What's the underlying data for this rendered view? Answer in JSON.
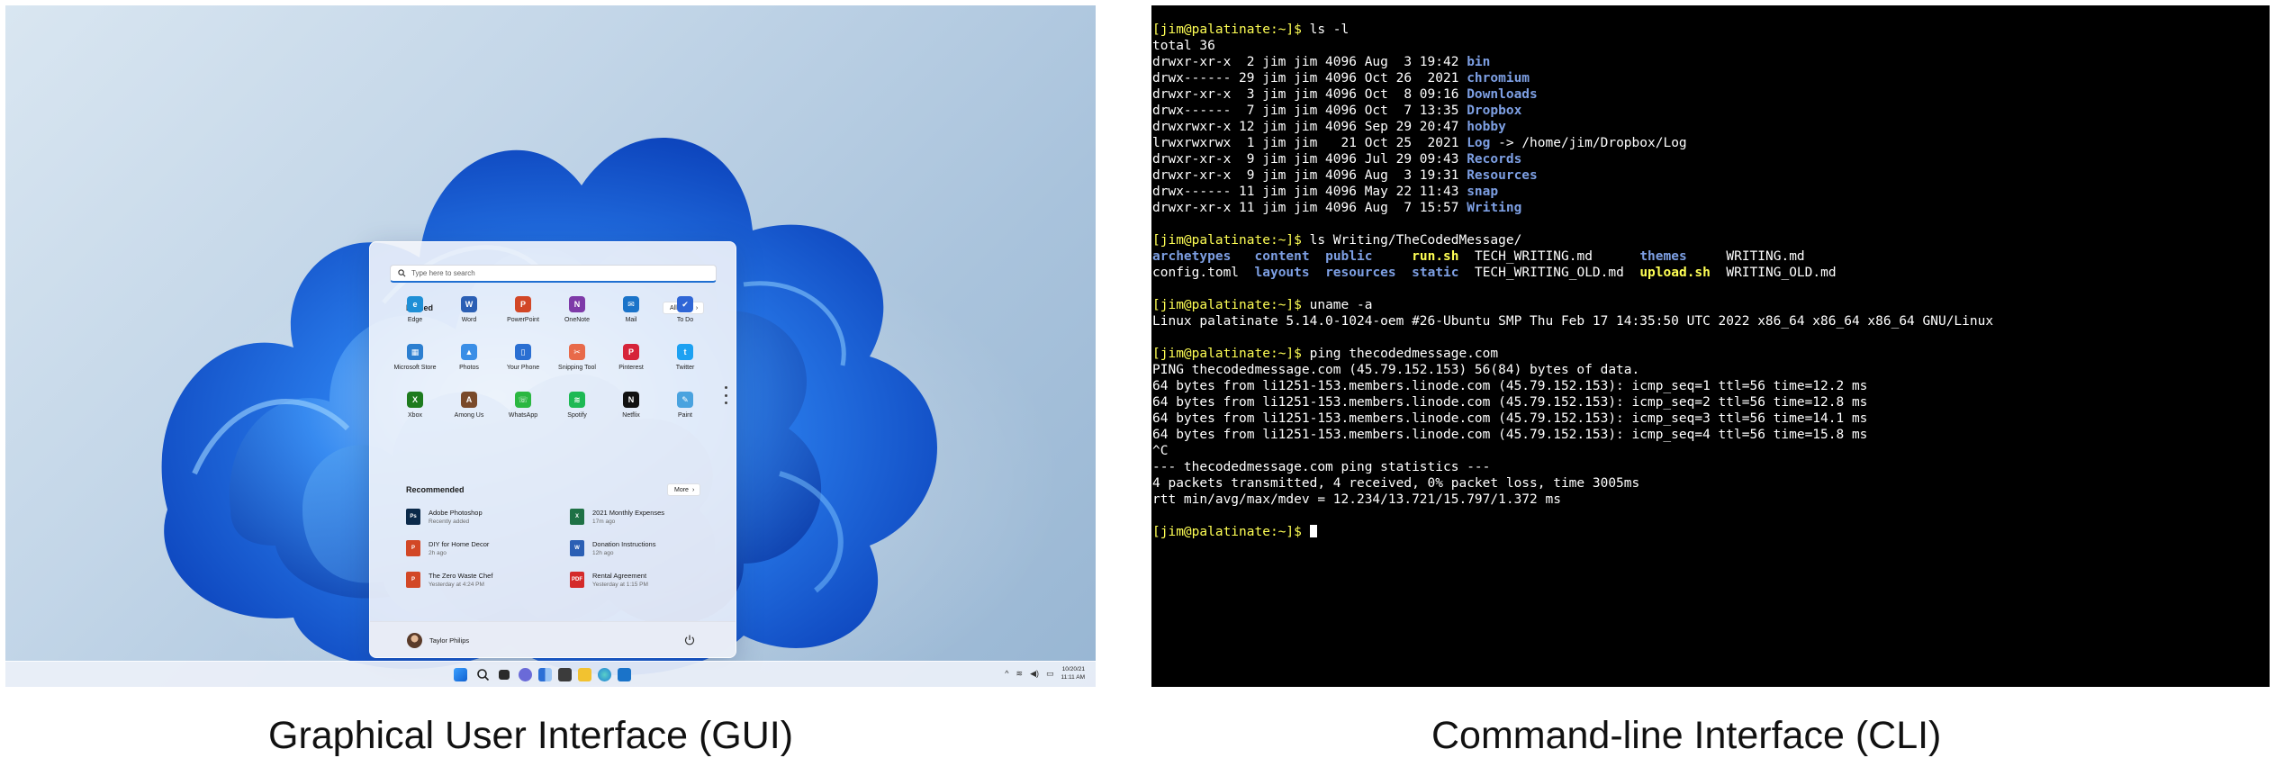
{
  "gui": {
    "search_placeholder": "Type here to search",
    "pinned_title": "Pinned",
    "all_apps_label": "All apps",
    "pinned_apps": [
      {
        "label": "Edge",
        "icon": "edge-icon",
        "color": "#1f8fd6",
        "glyph": "e"
      },
      {
        "label": "Word",
        "icon": "word-icon",
        "color": "#2b5fb4",
        "glyph": "W"
      },
      {
        "label": "PowerPoint",
        "icon": "powerpoint-icon",
        "color": "#d24726",
        "glyph": "P"
      },
      {
        "label": "OneNote",
        "icon": "onenote-icon",
        "color": "#7e3aa8",
        "glyph": "N"
      },
      {
        "label": "Mail",
        "icon": "mail-icon",
        "color": "#1a73c9",
        "glyph": "✉"
      },
      {
        "label": "To Do",
        "icon": "todo-icon",
        "color": "#2f66d6",
        "glyph": "✔"
      },
      {
        "label": "Microsoft Store",
        "icon": "store-icon",
        "color": "#2c7fd0",
        "glyph": "▦"
      },
      {
        "label": "Photos",
        "icon": "photos-icon",
        "color": "#3a8ee6",
        "glyph": "▲"
      },
      {
        "label": "Your Phone",
        "icon": "phone-icon",
        "color": "#2a6fd2",
        "glyph": "▯"
      },
      {
        "label": "Snipping Tool",
        "icon": "snipping-tool-icon",
        "color": "#e86a4a",
        "glyph": "✂"
      },
      {
        "label": "Pinterest",
        "icon": "pinterest-icon",
        "color": "#d6243a",
        "glyph": "P"
      },
      {
        "label": "Twitter",
        "icon": "twitter-icon",
        "color": "#1da1f2",
        "glyph": "t"
      },
      {
        "label": "Xbox",
        "icon": "xbox-icon",
        "color": "#1e7b1e",
        "glyph": "X"
      },
      {
        "label": "Among Us",
        "icon": "among-us-icon",
        "color": "#7a4a2a",
        "glyph": "A"
      },
      {
        "label": "WhatsApp",
        "icon": "whatsapp-icon",
        "color": "#2bb741",
        "glyph": "☏"
      },
      {
        "label": "Spotify",
        "icon": "spotify-icon",
        "color": "#1db954",
        "glyph": "≋"
      },
      {
        "label": "Netflix",
        "icon": "netflix-icon",
        "color": "#111111",
        "glyph": "N"
      },
      {
        "label": "Paint",
        "icon": "paint-icon",
        "color": "#4aa3df",
        "glyph": "✎"
      }
    ],
    "recommended_title": "Recommended",
    "more_label": "More",
    "recommended": [
      {
        "name": "Adobe Photoshop",
        "time": "Recently added",
        "icon": "photoshop-icon",
        "color": "#0b2a4a",
        "glyph": "Ps"
      },
      {
        "name": "2021 Monthly Expenses",
        "time": "17m ago",
        "icon": "excel-icon",
        "color": "#1e7145",
        "glyph": "X"
      },
      {
        "name": "DIY for Home Decor",
        "time": "2h ago",
        "icon": "powerpoint-file-icon",
        "color": "#d24726",
        "glyph": "P"
      },
      {
        "name": "Donation Instructions",
        "time": "12h ago",
        "icon": "word-file-icon",
        "color": "#2b5fb4",
        "glyph": "W"
      },
      {
        "name": "The Zero Waste Chef",
        "time": "Yesterday at 4:24 PM",
        "icon": "powerpoint-file-icon",
        "color": "#d24726",
        "glyph": "P"
      },
      {
        "name": "Rental Agreement",
        "time": "Yesterday at 1:15 PM",
        "icon": "pdf-file-icon",
        "color": "#d42a2a",
        "glyph": "PDF"
      }
    ],
    "user_name": "Taylor Philips",
    "clock_date": "10/20/21",
    "clock_time": "11:11 AM"
  },
  "cli": {
    "lines": [
      [
        {
          "t": "[jim@palatinate:~]$",
          "c": "prompt"
        },
        {
          "t": " ls -l"
        }
      ],
      [
        {
          "t": "total 36"
        }
      ],
      [
        {
          "t": "drwxr-xr-x  2 jim jim 4096 Aug  3 19:42 "
        },
        {
          "t": "bin",
          "c": "dir"
        }
      ],
      [
        {
          "t": "drwx------ 29 jim jim 4096 Oct 26  2021 "
        },
        {
          "t": "chromium",
          "c": "dir"
        }
      ],
      [
        {
          "t": "drwxr-xr-x  3 jim jim 4096 Oct  8 09:16 "
        },
        {
          "t": "Downloads",
          "c": "dir"
        }
      ],
      [
        {
          "t": "drwx------  7 jim jim 4096 Oct  7 13:35 "
        },
        {
          "t": "Dropbox",
          "c": "dir"
        }
      ],
      [
        {
          "t": "drwxrwxr-x 12 jim jim 4096 Sep 29 20:47 "
        },
        {
          "t": "hobby",
          "c": "dir"
        }
      ],
      [
        {
          "t": "lrwxrwxrwx  1 jim jim   21 Oct 25  2021 "
        },
        {
          "t": "Log",
          "c": "dir"
        },
        {
          "t": " -> /home/jim/Dropbox/Log"
        }
      ],
      [
        {
          "t": "drwxr-xr-x  9 jim jim 4096 Jul 29 09:43 "
        },
        {
          "t": "Records",
          "c": "dir"
        }
      ],
      [
        {
          "t": "drwxr-xr-x  9 jim jim 4096 Aug  3 19:31 "
        },
        {
          "t": "Resources",
          "c": "dir"
        }
      ],
      [
        {
          "t": "drwx------ 11 jim jim 4096 May 22 11:43 "
        },
        {
          "t": "snap",
          "c": "dir"
        }
      ],
      [
        {
          "t": "drwxr-xr-x 11 jim jim 4096 Aug  7 15:57 "
        },
        {
          "t": "Writing",
          "c": "dir"
        }
      ],
      [],
      [
        {
          "t": "[jim@palatinate:~]$",
          "c": "prompt"
        },
        {
          "t": " ls Writing/TheCodedMessage/"
        }
      ],
      [
        {
          "t": "archetypes",
          "c": "dir"
        },
        {
          "t": "   "
        },
        {
          "t": "content",
          "c": "dir"
        },
        {
          "t": "  "
        },
        {
          "t": "public",
          "c": "dir"
        },
        {
          "t": "     "
        },
        {
          "t": "run.sh",
          "c": "exe"
        },
        {
          "t": "  TECH_WRITING.md      "
        },
        {
          "t": "themes",
          "c": "dir"
        },
        {
          "t": "     WRITING.md"
        }
      ],
      [
        {
          "t": "config.toml  "
        },
        {
          "t": "layouts",
          "c": "dir"
        },
        {
          "t": "  "
        },
        {
          "t": "resources",
          "c": "dir"
        },
        {
          "t": "  "
        },
        {
          "t": "static",
          "c": "dir"
        },
        {
          "t": "  TECH_WRITING_OLD.md  "
        },
        {
          "t": "upload.sh",
          "c": "exe"
        },
        {
          "t": "  WRITING_OLD.md"
        }
      ],
      [],
      [
        {
          "t": "[jim@palatinate:~]$",
          "c": "prompt"
        },
        {
          "t": " uname -a"
        }
      ],
      [
        {
          "t": "Linux palatinate 5.14.0-1024-oem #26-Ubuntu SMP Thu Feb 17 14:35:50 UTC 2022 x86_64 x86_64 x86_64 GNU/Linux"
        }
      ],
      [],
      [
        {
          "t": "[jim@palatinate:~]$",
          "c": "prompt"
        },
        {
          "t": " ping thecodedmessage.com"
        }
      ],
      [
        {
          "t": "PING thecodedmessage.com (45.79.152.153) 56(84) bytes of data."
        }
      ],
      [
        {
          "t": "64 bytes from li1251-153.members.linode.com (45.79.152.153): icmp_seq=1 ttl=56 time=12.2 ms"
        }
      ],
      [
        {
          "t": "64 bytes from li1251-153.members.linode.com (45.79.152.153): icmp_seq=2 ttl=56 time=12.8 ms"
        }
      ],
      [
        {
          "t": "64 bytes from li1251-153.members.linode.com (45.79.152.153): icmp_seq=3 ttl=56 time=14.1 ms"
        }
      ],
      [
        {
          "t": "64 bytes from li1251-153.members.linode.com (45.79.152.153): icmp_seq=4 ttl=56 time=15.8 ms"
        }
      ],
      [
        {
          "t": "^C"
        }
      ],
      [
        {
          "t": "--- thecodedmessage.com ping statistics ---"
        }
      ],
      [
        {
          "t": "4 packets transmitted, 4 received, 0% packet loss, time 3005ms"
        }
      ],
      [
        {
          "t": "rtt min/avg/max/mdev = 12.234/13.721/15.797/1.372 ms"
        }
      ],
      [],
      [
        {
          "t": "[jim@palatinate:~]$",
          "c": "prompt"
        },
        {
          "t": " "
        },
        {
          "t": "",
          "c": "cursor"
        }
      ]
    ]
  },
  "captions": {
    "gui": "Graphical User Interface (GUI)",
    "cli": "Command-line Interface (CLI)"
  },
  "colors": {
    "prompt": "#ffff54",
    "directory": "#7d9fe3",
    "executable": "#ffff54",
    "terminal_bg": "#000000",
    "accent_blue": "#1f6fd1"
  }
}
